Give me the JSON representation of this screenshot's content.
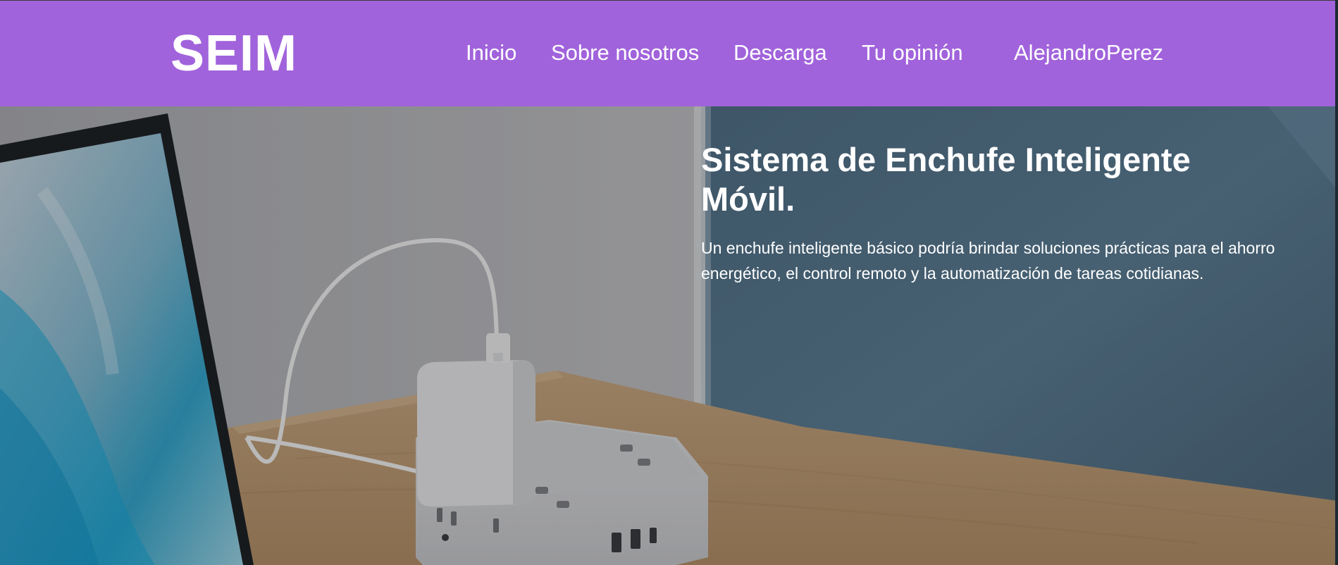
{
  "brand": {
    "logo_text": "SEIM"
  },
  "nav": {
    "items": [
      {
        "label": "Inicio"
      },
      {
        "label": "Sobre nosotros"
      },
      {
        "label": "Descarga"
      },
      {
        "label": "Tu opinión"
      },
      {
        "label": "AlejandroPerez"
      }
    ]
  },
  "hero": {
    "title_line1": "Sistema de Enchufe Inteligente",
    "title_line2": "Móvil.",
    "description_line1": "Un enchufe inteligente básico podría brindar soluciones prácticas para el ahorro",
    "description_line2": "energético, el control remoto y la automatización de tareas cotidianas.",
    "image_subject": "laptop and smart power strip on a wooden desk"
  },
  "colors": {
    "header_bg": "#a163db",
    "text": "#ffffff"
  }
}
